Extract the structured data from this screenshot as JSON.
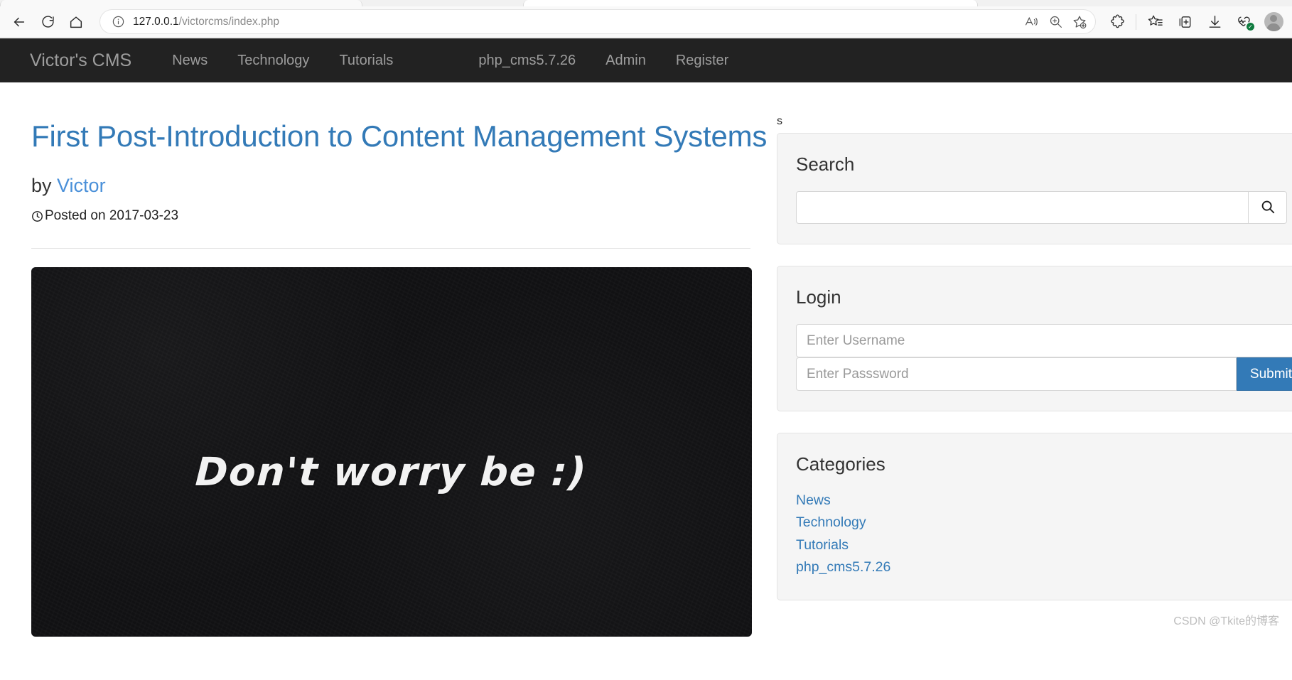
{
  "browser": {
    "url_host": "127.0.0.1",
    "url_path": "/victorcms/index.php",
    "back_icon": "back-arrow-icon",
    "reload_icon": "reload-icon",
    "home_icon": "home-icon",
    "info_icon": "info-circle-icon",
    "read_aloud_icon": "read-aloud-icon",
    "zoom_icon": "zoom-in-icon",
    "add_favorite_icon": "add-favorite-star-icon",
    "extensions_icon": "extensions-puzzle-icon",
    "favorites_icon": "favorites-list-icon",
    "collections_icon": "collections-icon",
    "downloads_icon": "downloads-icon",
    "browser_essentials_icon": "browser-essentials-icon",
    "profile_icon": "profile-avatar-icon"
  },
  "site": {
    "brand": "Victor's CMS",
    "nav_left": [
      {
        "label": "News"
      },
      {
        "label": "Technology"
      },
      {
        "label": "Tutorials"
      }
    ],
    "nav_right": [
      {
        "label": "php_cms5.7.26"
      },
      {
        "label": "Admin"
      },
      {
        "label": "Register"
      }
    ]
  },
  "post": {
    "title": "First Post-Introduction to Content Management Systems",
    "by_prefix": "by ",
    "author": "Victor",
    "posted_label": "Posted on 2017-03-23",
    "clock_icon": "clock-icon",
    "image_text": "Don't worry be :)"
  },
  "sidebar": {
    "stray_text": "s",
    "search": {
      "title": "Search",
      "input_value": "",
      "placeholder": "",
      "button_icon": "search-magnifier-icon"
    },
    "login": {
      "title": "Login",
      "username_value": "",
      "username_placeholder": "Enter Username",
      "password_value": "",
      "password_placeholder": "Enter Passsword",
      "submit_label": "Submit"
    },
    "categories": {
      "title": "Categories",
      "items": [
        {
          "label": "News"
        },
        {
          "label": "Technology"
        },
        {
          "label": "Tutorials"
        },
        {
          "label": "php_cms5.7.26"
        }
      ]
    }
  },
  "watermark": "CSDN @Tkite的博客",
  "colors": {
    "nav_bg": "#222222",
    "link_blue": "#337ab7",
    "primary_btn": "#337ab7",
    "widget_bg": "#f5f5f5"
  }
}
